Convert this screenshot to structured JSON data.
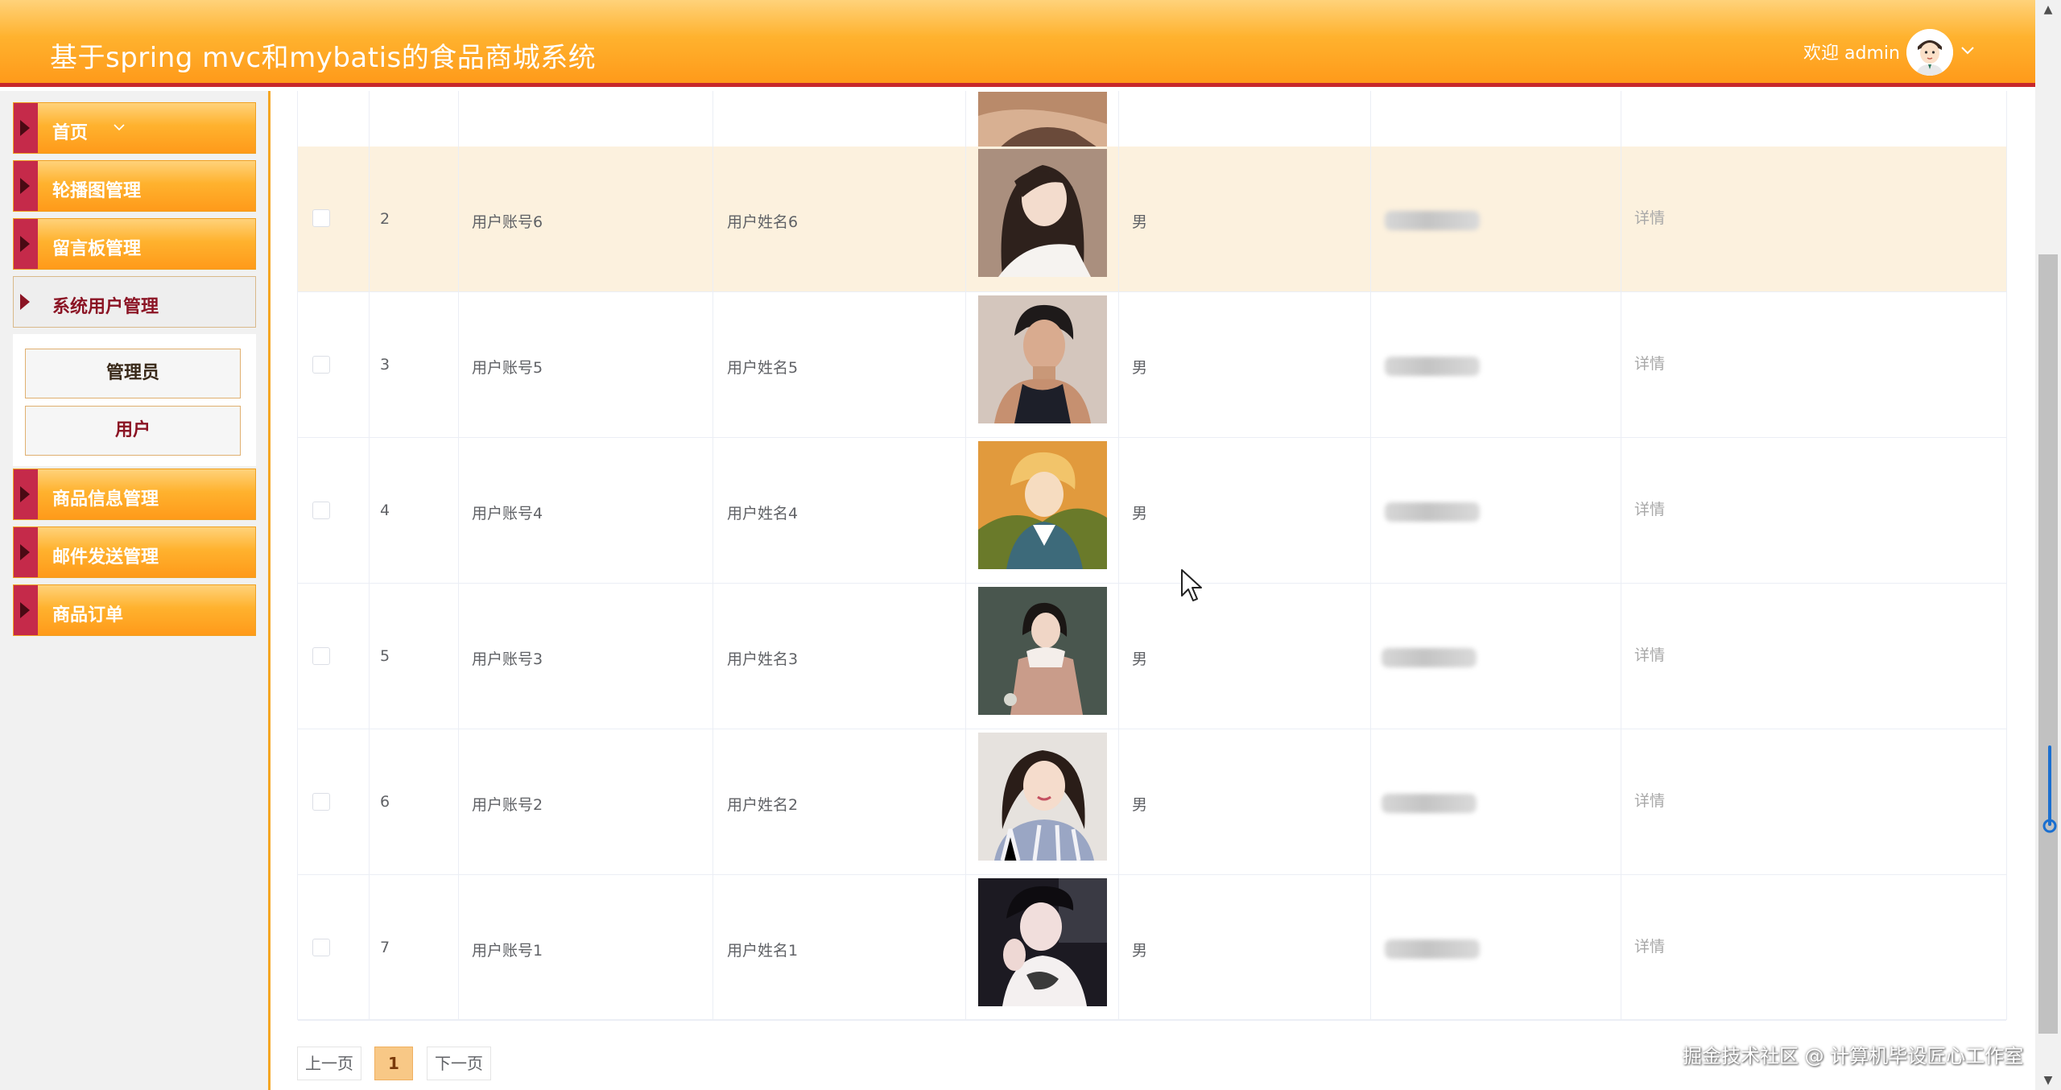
{
  "header": {
    "title": "基于spring mvc和mybatis的食品商城系统",
    "welcome": "欢迎 admin",
    "avatar_icon": "user-avatar-icon",
    "dropdown_icon": "chevron-down-icon"
  },
  "sidebar": {
    "items": [
      {
        "label": "首页"
      },
      {
        "label": "轮播图管理"
      },
      {
        "label": "留言板管理"
      },
      {
        "label": "系统用户管理"
      },
      {
        "label": "商品信息管理"
      },
      {
        "label": "邮件发送管理"
      },
      {
        "label": "商品订单"
      }
    ],
    "submenu": [
      {
        "label": "管理员"
      },
      {
        "label": "用户"
      }
    ]
  },
  "table": {
    "rows": [
      {
        "index": "2",
        "account": "用户账号6",
        "name": "用户姓名6",
        "gender": "男",
        "detail": "详情",
        "photo_icon": "user-photo"
      },
      {
        "index": "3",
        "account": "用户账号5",
        "name": "用户姓名5",
        "gender": "男",
        "detail": "详情",
        "photo_icon": "user-photo"
      },
      {
        "index": "4",
        "account": "用户账号4",
        "name": "用户姓名4",
        "gender": "男",
        "detail": "详情",
        "photo_icon": "user-photo"
      },
      {
        "index": "5",
        "account": "用户账号3",
        "name": "用户姓名3",
        "gender": "男",
        "detail": "详情",
        "photo_icon": "user-photo"
      },
      {
        "index": "6",
        "account": "用户账号2",
        "name": "用户姓名2",
        "gender": "男",
        "detail": "详情",
        "photo_icon": "user-photo"
      },
      {
        "index": "7",
        "account": "用户账号1",
        "name": "用户姓名1",
        "gender": "男",
        "detail": "详情",
        "photo_icon": "user-photo"
      }
    ]
  },
  "pagination": {
    "prev": "上一页",
    "current": "1",
    "next": "下一页"
  },
  "watermark": "掘金技术社区 @ 计算机毕设匠心工作室",
  "colors": {
    "header_orange": "#ffb22e",
    "header_border": "#c7272b",
    "nav_arrow": "#c52a4a",
    "row_highlight": "#fcf1de",
    "active_text": "#8b1424"
  }
}
